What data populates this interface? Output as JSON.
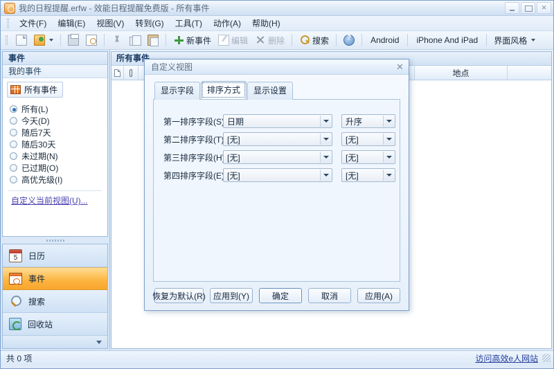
{
  "window": {
    "title": "我的日程提醒.erfw - 效能日程提醒免费版 - 所有事件",
    "icon": "app-icon",
    "minimize_label": "最小化",
    "maximize_label": "最大化",
    "close_label": "关闭"
  },
  "menubar": {
    "items": [
      {
        "label": "文件(F)"
      },
      {
        "label": "编辑(E)"
      },
      {
        "label": "视图(V)"
      },
      {
        "label": "转到(G)"
      },
      {
        "label": "工具(T)"
      },
      {
        "label": "动作(A)"
      },
      {
        "label": "帮助(H)"
      }
    ]
  },
  "toolbar": {
    "new_icon": "new-document-icon",
    "open_icon": "open-folder-icon",
    "print_icon": "print-icon",
    "preview_icon": "print-preview-icon",
    "cut_icon": "cut-icon",
    "copy_icon": "copy-icon",
    "paste_icon": "paste-icon",
    "new_event_label": "新事件",
    "edit_label": "编辑",
    "delete_label": "删除",
    "search_label": "搜索",
    "help_icon": "help-icon",
    "android_label": "Android",
    "iphone_label": "iPhone And iPad",
    "skin_label": "界面风格"
  },
  "sidebar": {
    "title": "事件",
    "subtitle": "我的事件",
    "chip": {
      "label": "所有事件",
      "icon": "events-grid-icon"
    },
    "filters": [
      {
        "label": "所有(L)",
        "selected": true
      },
      {
        "label": "今天(D)",
        "selected": false
      },
      {
        "label": "随后7天",
        "selected": false
      },
      {
        "label": "随后30天",
        "selected": false
      },
      {
        "label": "未过期(N)",
        "selected": false
      },
      {
        "label": "已过期(O)",
        "selected": false
      },
      {
        "label": "高优先级(I)",
        "selected": false
      }
    ],
    "customize_link": "自定义当前视图(U)...",
    "nav": [
      {
        "label": "日历",
        "icon": "calendar-icon",
        "active": false
      },
      {
        "label": "事件",
        "icon": "events-icon",
        "active": true
      },
      {
        "label": "搜索",
        "icon": "magnifier-icon",
        "active": false
      },
      {
        "label": "回收站",
        "icon": "recycle-bin-icon",
        "active": false
      }
    ],
    "nav_more_icon": "chevron-down-icon"
  },
  "main": {
    "title": "所有事件",
    "columns": [
      {
        "label": "",
        "icon": "document-icon"
      },
      {
        "label": "",
        "icon": "attachment-icon"
      },
      {
        "label": ""
      },
      {
        "label": "地点"
      },
      {
        "label": ""
      }
    ]
  },
  "dialog": {
    "title": "自定义视图",
    "close_icon": "close-icon",
    "tabs": [
      {
        "label": "显示字段",
        "active": false
      },
      {
        "label": "排序方式",
        "active": true
      },
      {
        "label": "显示设置",
        "active": false
      }
    ],
    "sort_rows": [
      {
        "label": "第一排序字段(S):",
        "field": "日期",
        "order": "升序"
      },
      {
        "label": "第二排序字段(T):",
        "field": "[无]",
        "order": "[无]"
      },
      {
        "label": "第三排序字段(H):",
        "field": "[无]",
        "order": "[无]"
      },
      {
        "label": "第四排序字段(E):",
        "field": "[无]",
        "order": "[无]"
      }
    ],
    "buttons": [
      {
        "label": "恢复为默认(R)",
        "default": false
      },
      {
        "label": "应用到(Y)",
        "default": false
      },
      {
        "label": "确定",
        "default": true
      },
      {
        "label": "取消",
        "default": false
      },
      {
        "label": "应用(A)",
        "default": false
      }
    ]
  },
  "statusbar": {
    "count_text": "共 0 项",
    "link_text": "访问高效e人网站"
  }
}
